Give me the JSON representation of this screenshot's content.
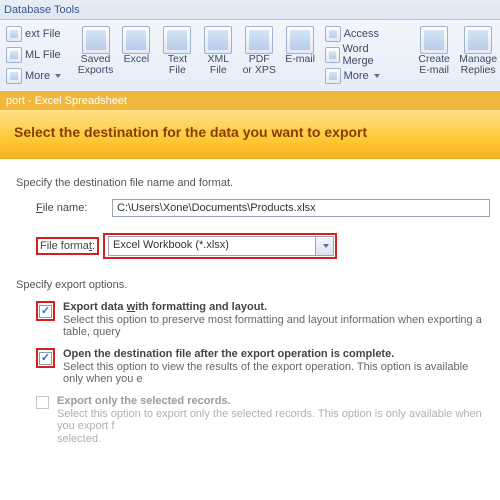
{
  "ribbon": {
    "tab": "Database Tools",
    "left": {
      "item1": "ext File",
      "item2": "ML File",
      "item3": "More"
    },
    "export": {
      "saved": "Saved\nExports",
      "excel": "Excel",
      "text": "Text\nFile",
      "xml": "XML\nFile",
      "pdf": "PDF\nor XPS",
      "email": "E-mail",
      "access": "Access",
      "wordmerge": "Word Merge",
      "more": "More"
    },
    "collect": {
      "create": "Create\nE-mail",
      "manage": "Manage\nReplies"
    }
  },
  "wizard": {
    "bar": "port - Excel Spreadsheet",
    "title": "Select the destination for the data you want to export",
    "specifyDest": "Specify the destination file name and format.",
    "fileNameLabelPrefix": "F",
    "fileNameLabel": "ile name:",
    "fileName": "C:\\Users\\Xone\\Documents\\Products.xlsx",
    "fileFormatLabelPrefix": "t",
    "fileFormatLabel": "File forma",
    "fileFormat": "Excel Workbook (*.xlsx)",
    "specifyOpts": "Specify export options.",
    "opt1": {
      "titlePrefix": "Export data ",
      "titleUnderline": "w",
      "titleRest": "ith formatting and layout.",
      "desc": "Select this option to preserve most formatting and layout information when exporting a table, query"
    },
    "opt2": {
      "title": "Open the destination file after the export operation is complete.",
      "desc": "Select this option to view the results of the export operation. This option is available only when you e"
    },
    "opt3": {
      "title": "Export only the selected records.",
      "desc": "Select this option to export only the selected records. This option is only available when you export f",
      "desc2": "selected."
    }
  }
}
